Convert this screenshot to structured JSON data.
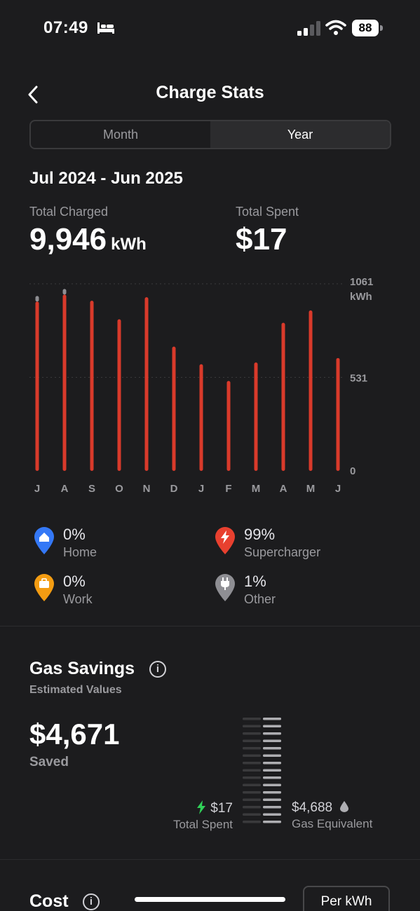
{
  "status": {
    "time": "07:49",
    "battery": "88"
  },
  "header": {
    "title": "Charge Stats"
  },
  "segments": {
    "month": "Month",
    "year": "Year",
    "selected": "Year"
  },
  "period": "Jul 2024 - Jun 2025",
  "totals": {
    "charged_label": "Total Charged",
    "charged_value": "9,946",
    "charged_unit": "kWh",
    "spent_label": "Total Spent",
    "spent_value": "$17"
  },
  "chart_data": {
    "type": "bar",
    "categories": [
      "J",
      "A",
      "S",
      "O",
      "N",
      "D",
      "J",
      "F",
      "M",
      "A",
      "M",
      "J"
    ],
    "values": [
      960,
      1000,
      965,
      860,
      985,
      705,
      605,
      510,
      615,
      840,
      910,
      640
    ],
    "ylim": [
      0,
      1061
    ],
    "yticks": [
      "1061",
      "531",
      "0"
    ],
    "yunit": "kWh",
    "bar_color": "#d93a2b",
    "marker_color": "#8e8e93"
  },
  "legend": [
    {
      "pct": "0%",
      "name": "Home",
      "color": "#3478f6",
      "icon": "home-icon"
    },
    {
      "pct": "99%",
      "name": "Supercharger",
      "color": "#e8402f",
      "icon": "lightning-icon"
    },
    {
      "pct": "0%",
      "name": "Work",
      "color": "#f39c12",
      "icon": "briefcase-icon"
    },
    {
      "pct": "1%",
      "name": "Other",
      "color": "#8e8e93",
      "icon": "plug-icon"
    }
  ],
  "gas": {
    "title": "Gas Savings",
    "subtitle": "Estimated Values",
    "saved_value": "$4,671",
    "saved_label": "Saved",
    "spent_value": "$17",
    "spent_label": "Total Spent",
    "gas_value": "$4,688",
    "gas_label": "Gas Equivalent",
    "accent": "#30d158"
  },
  "cost": {
    "title": "Cost",
    "per_kwh": "Per kWh"
  }
}
